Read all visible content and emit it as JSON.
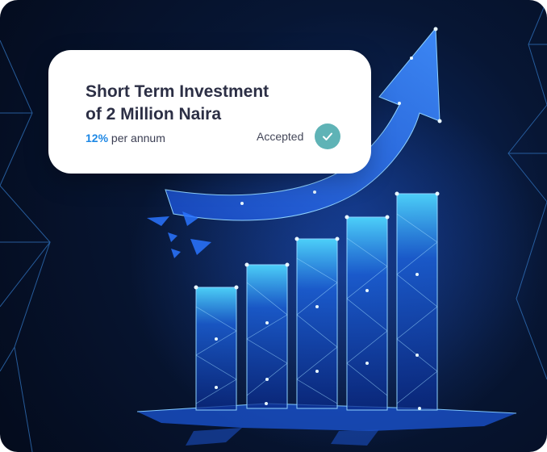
{
  "card": {
    "title_line1": "Short Term Investment",
    "title_line2": "of 2 Million Naira",
    "rate_value": "12%",
    "rate_suffix": "per annum",
    "status": "Accepted",
    "status_icon": "check-icon"
  },
  "colors": {
    "background": "#071634",
    "accent_blue": "#1e88e5",
    "status_teal": "#5fb3b6",
    "glow": "#4aa8ff"
  },
  "illustration": {
    "subject": "growth-bar-chart-with-arrow",
    "bar_count": 5
  }
}
